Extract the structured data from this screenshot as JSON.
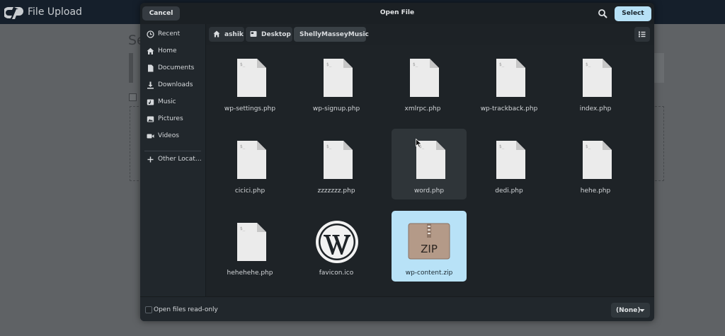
{
  "background": {
    "app_title": "File Upload",
    "section_heading_fragment": "Se"
  },
  "dialog": {
    "title": "Open File",
    "cancel_label": "Cancel",
    "select_label": "Select",
    "search_icon": "search-icon"
  },
  "sidebar": {
    "items": [
      {
        "label": "Recent",
        "icon": "clock-icon"
      },
      {
        "label": "Home",
        "icon": "home-icon"
      },
      {
        "label": "Documents",
        "icon": "document-icon"
      },
      {
        "label": "Downloads",
        "icon": "download-icon"
      },
      {
        "label": "Music",
        "icon": "music-icon"
      },
      {
        "label": "Pictures",
        "icon": "picture-icon"
      },
      {
        "label": "Videos",
        "icon": "video-icon"
      },
      {
        "label": "Other Locat…",
        "icon": "plus-icon"
      }
    ]
  },
  "pathbar": {
    "crumbs": [
      {
        "label": "ashik",
        "icon": "home-icon"
      },
      {
        "label": "Desktop",
        "icon": "desktop-icon"
      },
      {
        "label": "ShellyMasseyMusic",
        "icon": ""
      }
    ],
    "view_toggle_icon": "list-view-icon"
  },
  "files": [
    {
      "name": "wp-settings.php",
      "type": "php"
    },
    {
      "name": "wp-signup.php",
      "type": "php"
    },
    {
      "name": "xmlrpc.php",
      "type": "php"
    },
    {
      "name": "wp-trackback.php",
      "type": "php"
    },
    {
      "name": "index.php",
      "type": "php"
    },
    {
      "name": "cicici.php",
      "type": "php"
    },
    {
      "name": "zzzzzzz.php",
      "type": "php"
    },
    {
      "name": "word.php",
      "type": "php",
      "state": "hover"
    },
    {
      "name": "dedi.php",
      "type": "php"
    },
    {
      "name": "hehe.php",
      "type": "php"
    },
    {
      "name": "hehehehe.php",
      "type": "php"
    },
    {
      "name": "favicon.ico",
      "type": "wordpress-logo"
    },
    {
      "name": "wp-content.zip",
      "type": "zip",
      "state": "selected",
      "badge": "ZIP"
    }
  ],
  "bottombar": {
    "readonly_label": "Open files read-only",
    "filter_label": "(None)"
  },
  "colors": {
    "accent": "#b7e1f6",
    "dialog_bg": "#1d2226",
    "sidebar_bg": "#21272c",
    "header_bg": "#151f2b"
  }
}
